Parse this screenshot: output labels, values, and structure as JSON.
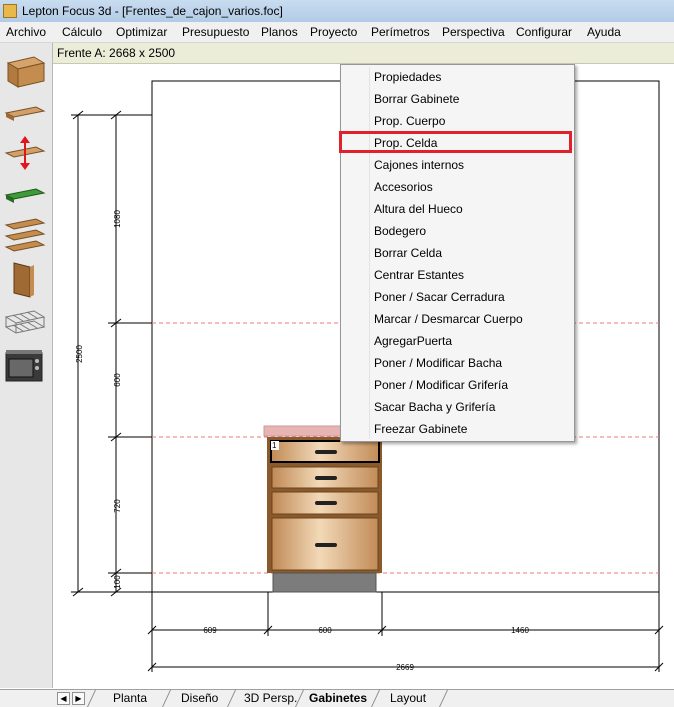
{
  "window": {
    "title": "Lepton Focus 3d - [Frentes_de_cajon_varios.foc]"
  },
  "menubar": {
    "items": [
      "Archivo",
      "Cálculo",
      "Optimizar",
      "Presupuesto",
      "Planos",
      "Proyecto",
      "Perímetros",
      "Perspectiva",
      "Configurar",
      "Ayuda"
    ]
  },
  "info": {
    "frente": "Frente A: 2668 x 2500"
  },
  "toolbar": {
    "tools": [
      "cabinet-box-icon",
      "shelf-icon",
      "move-shelf-icon",
      "green-shelf-icon",
      "stacked-shelves-icon",
      "door-panel-icon",
      "wire-basket-icon",
      "oven-icon"
    ]
  },
  "dimensions": {
    "left_total": "2500",
    "left_segments": [
      "1080",
      "600",
      "720",
      "100"
    ],
    "bottom_segments": [
      "609",
      "600",
      "1460"
    ],
    "bottom_total": "2669",
    "cell_label": "1"
  },
  "context_menu": {
    "items": [
      "Propiedades",
      "Borrar Gabinete",
      "Prop. Cuerpo",
      "Prop. Celda",
      "Cajones internos",
      "Accesorios",
      "Altura del Hueco",
      "Bodegero",
      "Borrar Celda",
      "Centrar Estantes",
      "Poner / Sacar Cerradura",
      "Marcar / Desmarcar Cuerpo",
      "AgregarPuerta",
      "Poner / Modificar Bacha",
      "Poner / Modificar Grifería",
      "Sacar Bacha y Grifería",
      "Freezar Gabinete"
    ],
    "highlighted": "Prop. Celda",
    "highlight_color": "#e0212b"
  },
  "tabs": {
    "items": [
      "Planta",
      "Diseño",
      "3D Persp.",
      "Gabinetes",
      "Layout"
    ],
    "active": "Gabinetes"
  }
}
